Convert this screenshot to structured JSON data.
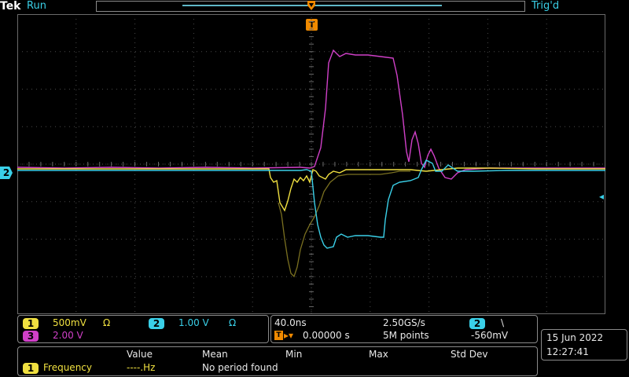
{
  "top": {
    "brand": "Tek",
    "run_state": "Run",
    "trigger_state": "Trig'd",
    "trigger_badge": "T"
  },
  "channels": {
    "ch1": {
      "number": "1",
      "scale": "500mV",
      "coupling": "Ω",
      "color": "#f0e040"
    },
    "ch2": {
      "number": "2",
      "scale": "1.00 V",
      "coupling": "Ω",
      "color": "#3ad0e8"
    },
    "ch3": {
      "number": "3",
      "scale": "2.00 V",
      "color": "#d040c8"
    }
  },
  "marker": {
    "ch2_label": "2"
  },
  "timebase": {
    "scale": "40.0ns",
    "trigger_position": "0.00000 s",
    "sample_rate": "2.50GS/s",
    "record_length": "5M points",
    "trigger_source": "2",
    "trigger_slope": "\\",
    "trigger_level": "-560mV"
  },
  "clock": {
    "date": "15 Jun   2022",
    "time": "12:27:41"
  },
  "measurements": {
    "headers": [
      "Value",
      "Mean",
      "Min",
      "Max",
      "Std Dev"
    ],
    "row": {
      "source": "1",
      "name": "Frequency",
      "value": "----.Hz",
      "status": "No period found"
    }
  }
}
